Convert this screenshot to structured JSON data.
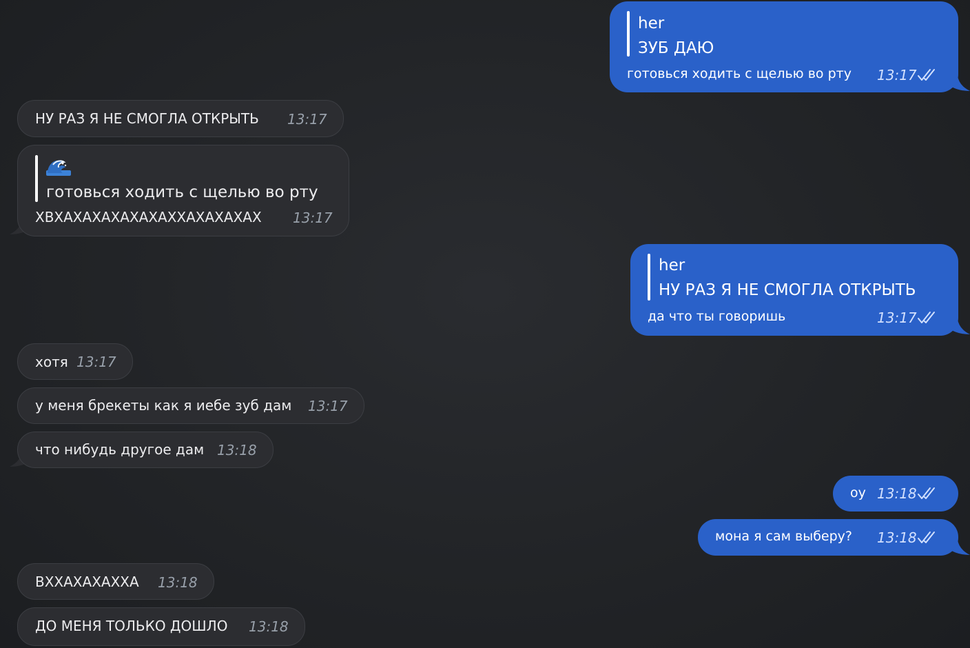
{
  "colors": {
    "background": "#222427",
    "incoming_bubble": "#2c2d31",
    "outgoing_bubble": "#2a61c9",
    "check": "#d3e1ff"
  },
  "messages": {
    "m1": {
      "quote_author": "her",
      "quote_text": "ЗУБ ДАЮ",
      "text": "готовься ходить с щелью во рту",
      "time": "13:17",
      "status_icon": "double-check-icon"
    },
    "m2": {
      "text": "НУ РАЗ Я НЕ СМОГЛА ОТКРЫТЬ",
      "time": "13:17"
    },
    "m3": {
      "quote_icon": "wave-emoji-icon",
      "quote_text": "готовься ходить с щелью во рту",
      "text": "ХВХАХАХАХАХАХАХХАХАХАХАХ",
      "time": "13:17"
    },
    "m4": {
      "quote_author": "her",
      "quote_text": "НУ РАЗ Я НЕ СМОГЛА ОТКРЫТЬ",
      "text": "да что ты говоришь",
      "time": "13:17",
      "status_icon": "double-check-icon"
    },
    "m5": {
      "text": "хотя",
      "time": "13:17"
    },
    "m6": {
      "text": "у меня брекеты как я иебе зуб дам",
      "time": "13:17"
    },
    "m7": {
      "text": "что нибудь другое дам",
      "time": "13:18"
    },
    "m8": {
      "text": "оу",
      "time": "13:18",
      "status_icon": "double-check-icon"
    },
    "m9": {
      "text": "мона я сам выберу?",
      "time": "13:18",
      "status_icon": "double-check-icon"
    },
    "m10": {
      "text": "ВХХАХАХАХХА",
      "time": "13:18"
    },
    "m11": {
      "text": "ДО МЕНЯ ТОЛЬКО ДОШЛО",
      "time": "13:18"
    }
  }
}
